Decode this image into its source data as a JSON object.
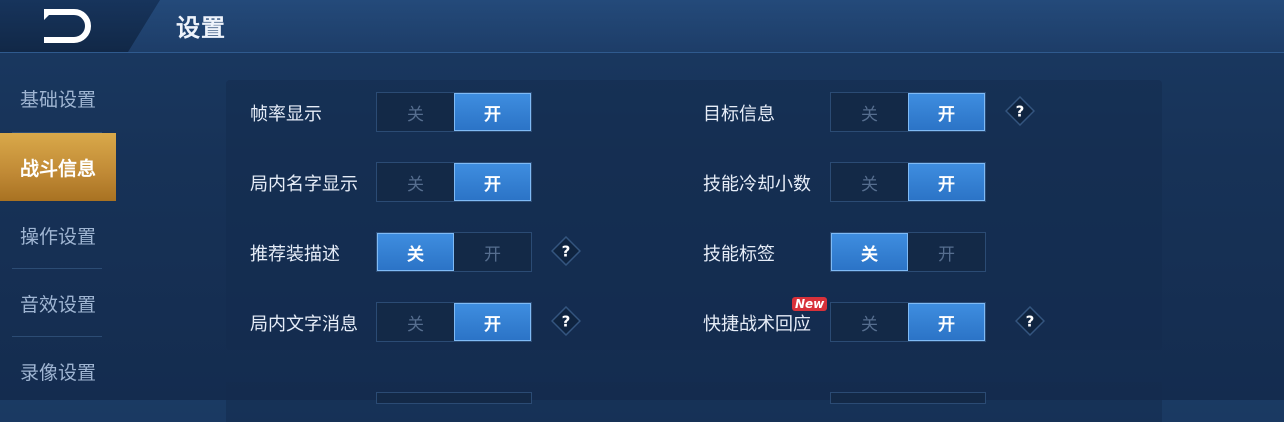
{
  "header": {
    "title": "设置",
    "back_icon": "back-arrow-icon"
  },
  "sidebar": {
    "items": [
      {
        "label": "基础设置",
        "active": false
      },
      {
        "label": "战斗信息",
        "active": true
      },
      {
        "label": "操作设置",
        "active": false
      },
      {
        "label": "音效设置",
        "active": false
      },
      {
        "label": "录像设置",
        "active": false
      }
    ]
  },
  "toggle_labels": {
    "off": "关",
    "on": "开"
  },
  "settings": {
    "left": [
      {
        "label": "帧率显示",
        "value": "开",
        "help": false
      },
      {
        "label": "局内名字显示",
        "value": "开",
        "help": false
      },
      {
        "label": "推荐装描述",
        "value": "关",
        "help": true
      },
      {
        "label": "局内文字消息",
        "value": "开",
        "help": true
      }
    ],
    "right": [
      {
        "label": "目标信息",
        "value": "开",
        "help": true
      },
      {
        "label": "技能冷却小数",
        "value": "开",
        "help": false
      },
      {
        "label": "技能标签",
        "value": "关",
        "help": false
      },
      {
        "label": "快捷战术回应",
        "value": "开",
        "help": true,
        "badge": "New"
      }
    ]
  },
  "help_glyph": "?",
  "colors": {
    "accent_blue": "#3f8ee0",
    "active_tab_gold": "#c08935",
    "badge_red": "#d8313a"
  }
}
